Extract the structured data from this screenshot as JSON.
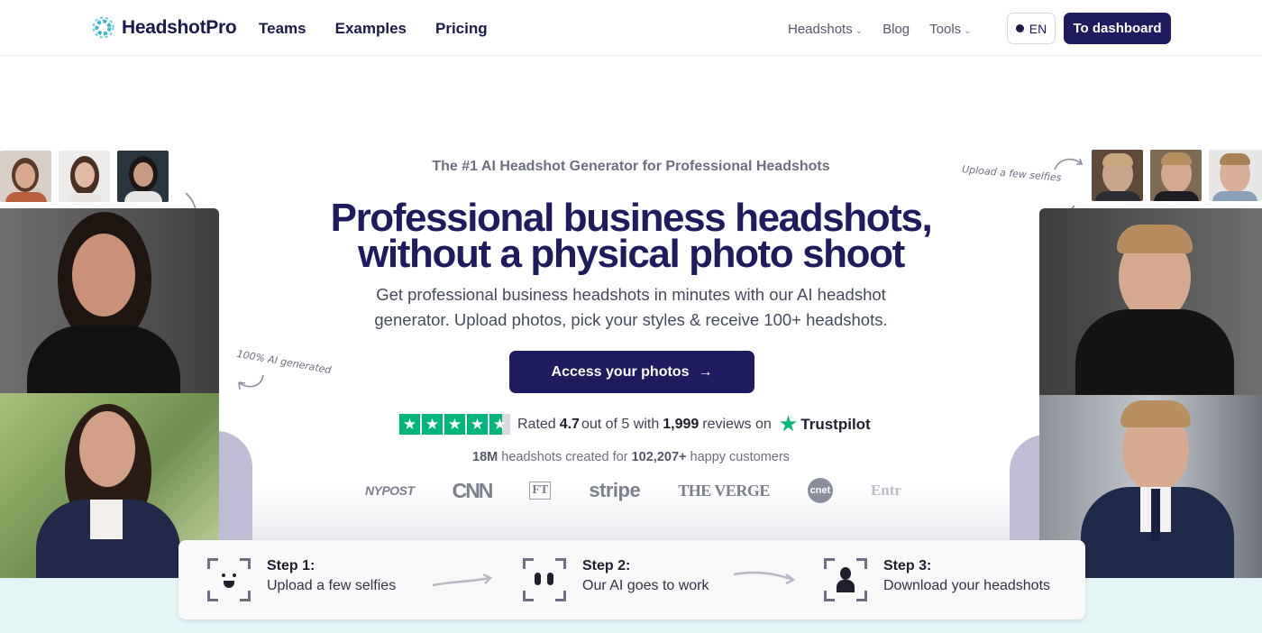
{
  "nav": {
    "logo_text": "HeadshotPro",
    "main_links": [
      "Teams",
      "Examples",
      "Pricing"
    ],
    "right_links": [
      {
        "label": "Headshots",
        "has_dropdown": true
      },
      {
        "label": "Blog",
        "has_dropdown": false
      },
      {
        "label": "Tools",
        "has_dropdown": true
      }
    ],
    "lang_label": "EN",
    "dashboard_label": "To dashboard"
  },
  "hero": {
    "eyebrow": "The #1 AI Headshot Generator for Professional Headshots",
    "headline_line1": "Professional business headshots,",
    "headline_line2": "without a physical photo shoot",
    "subtext": "Get professional business headshots in minutes with our AI headshot generator. Upload photos, pick your styles & receive 100+ headshots.",
    "cta_label": "Access your photos",
    "cta_arrow": "→"
  },
  "rating": {
    "prefix": "Rated",
    "score": "4.7",
    "middle": "out of 5 with",
    "count": "1,999",
    "suffix": "reviews on",
    "platform": "Trustpilot",
    "stars": 4.5
  },
  "stats": {
    "headshots": "18M",
    "headshots_label": "headshots created for",
    "customers": "102,207+",
    "customers_label": "happy customers"
  },
  "press": [
    "NYPOST",
    "CNN",
    "FT",
    "stripe",
    "THE VERGE",
    "cnet",
    "Entr"
  ],
  "notes": {
    "left": "100% AI generated",
    "right": "Upload a few selfies"
  },
  "steps": [
    {
      "title": "Step 1:",
      "subtitle": "Upload a few selfies",
      "icon": "smile-face-icon"
    },
    {
      "title": "Step 2:",
      "subtitle": "Our AI goes to work",
      "icon": "ai-eyes-icon"
    },
    {
      "title": "Step 3:",
      "subtitle": "Download your headshots",
      "icon": "person-icon"
    }
  ],
  "colors": {
    "brand": "#1e1b5e",
    "trustpilot": "#00b67a",
    "band": "#e4f5f6"
  }
}
